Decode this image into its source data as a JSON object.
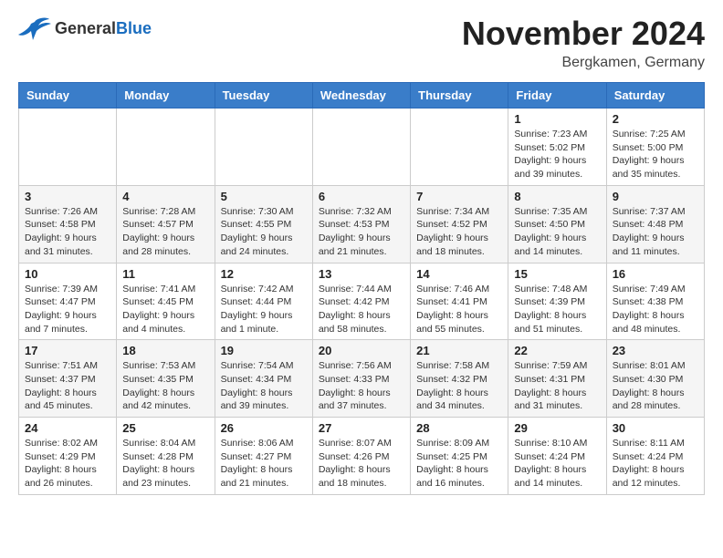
{
  "header": {
    "logo_general": "General",
    "logo_blue": "Blue",
    "month_title": "November 2024",
    "location": "Bergkamen, Germany"
  },
  "days_of_week": [
    "Sunday",
    "Monday",
    "Tuesday",
    "Wednesday",
    "Thursday",
    "Friday",
    "Saturday"
  ],
  "weeks": [
    [
      {
        "day": "",
        "info": ""
      },
      {
        "day": "",
        "info": ""
      },
      {
        "day": "",
        "info": ""
      },
      {
        "day": "",
        "info": ""
      },
      {
        "day": "",
        "info": ""
      },
      {
        "day": "1",
        "info": "Sunrise: 7:23 AM\nSunset: 5:02 PM\nDaylight: 9 hours and 39 minutes."
      },
      {
        "day": "2",
        "info": "Sunrise: 7:25 AM\nSunset: 5:00 PM\nDaylight: 9 hours and 35 minutes."
      }
    ],
    [
      {
        "day": "3",
        "info": "Sunrise: 7:26 AM\nSunset: 4:58 PM\nDaylight: 9 hours and 31 minutes."
      },
      {
        "day": "4",
        "info": "Sunrise: 7:28 AM\nSunset: 4:57 PM\nDaylight: 9 hours and 28 minutes."
      },
      {
        "day": "5",
        "info": "Sunrise: 7:30 AM\nSunset: 4:55 PM\nDaylight: 9 hours and 24 minutes."
      },
      {
        "day": "6",
        "info": "Sunrise: 7:32 AM\nSunset: 4:53 PM\nDaylight: 9 hours and 21 minutes."
      },
      {
        "day": "7",
        "info": "Sunrise: 7:34 AM\nSunset: 4:52 PM\nDaylight: 9 hours and 18 minutes."
      },
      {
        "day": "8",
        "info": "Sunrise: 7:35 AM\nSunset: 4:50 PM\nDaylight: 9 hours and 14 minutes."
      },
      {
        "day": "9",
        "info": "Sunrise: 7:37 AM\nSunset: 4:48 PM\nDaylight: 9 hours and 11 minutes."
      }
    ],
    [
      {
        "day": "10",
        "info": "Sunrise: 7:39 AM\nSunset: 4:47 PM\nDaylight: 9 hours and 7 minutes."
      },
      {
        "day": "11",
        "info": "Sunrise: 7:41 AM\nSunset: 4:45 PM\nDaylight: 9 hours and 4 minutes."
      },
      {
        "day": "12",
        "info": "Sunrise: 7:42 AM\nSunset: 4:44 PM\nDaylight: 9 hours and 1 minute."
      },
      {
        "day": "13",
        "info": "Sunrise: 7:44 AM\nSunset: 4:42 PM\nDaylight: 8 hours and 58 minutes."
      },
      {
        "day": "14",
        "info": "Sunrise: 7:46 AM\nSunset: 4:41 PM\nDaylight: 8 hours and 55 minutes."
      },
      {
        "day": "15",
        "info": "Sunrise: 7:48 AM\nSunset: 4:39 PM\nDaylight: 8 hours and 51 minutes."
      },
      {
        "day": "16",
        "info": "Sunrise: 7:49 AM\nSunset: 4:38 PM\nDaylight: 8 hours and 48 minutes."
      }
    ],
    [
      {
        "day": "17",
        "info": "Sunrise: 7:51 AM\nSunset: 4:37 PM\nDaylight: 8 hours and 45 minutes."
      },
      {
        "day": "18",
        "info": "Sunrise: 7:53 AM\nSunset: 4:35 PM\nDaylight: 8 hours and 42 minutes."
      },
      {
        "day": "19",
        "info": "Sunrise: 7:54 AM\nSunset: 4:34 PM\nDaylight: 8 hours and 39 minutes."
      },
      {
        "day": "20",
        "info": "Sunrise: 7:56 AM\nSunset: 4:33 PM\nDaylight: 8 hours and 37 minutes."
      },
      {
        "day": "21",
        "info": "Sunrise: 7:58 AM\nSunset: 4:32 PM\nDaylight: 8 hours and 34 minutes."
      },
      {
        "day": "22",
        "info": "Sunrise: 7:59 AM\nSunset: 4:31 PM\nDaylight: 8 hours and 31 minutes."
      },
      {
        "day": "23",
        "info": "Sunrise: 8:01 AM\nSunset: 4:30 PM\nDaylight: 8 hours and 28 minutes."
      }
    ],
    [
      {
        "day": "24",
        "info": "Sunrise: 8:02 AM\nSunset: 4:29 PM\nDaylight: 8 hours and 26 minutes."
      },
      {
        "day": "25",
        "info": "Sunrise: 8:04 AM\nSunset: 4:28 PM\nDaylight: 8 hours and 23 minutes."
      },
      {
        "day": "26",
        "info": "Sunrise: 8:06 AM\nSunset: 4:27 PM\nDaylight: 8 hours and 21 minutes."
      },
      {
        "day": "27",
        "info": "Sunrise: 8:07 AM\nSunset: 4:26 PM\nDaylight: 8 hours and 18 minutes."
      },
      {
        "day": "28",
        "info": "Sunrise: 8:09 AM\nSunset: 4:25 PM\nDaylight: 8 hours and 16 minutes."
      },
      {
        "day": "29",
        "info": "Sunrise: 8:10 AM\nSunset: 4:24 PM\nDaylight: 8 hours and 14 minutes."
      },
      {
        "day": "30",
        "info": "Sunrise: 8:11 AM\nSunset: 4:24 PM\nDaylight: 8 hours and 12 minutes."
      }
    ]
  ]
}
